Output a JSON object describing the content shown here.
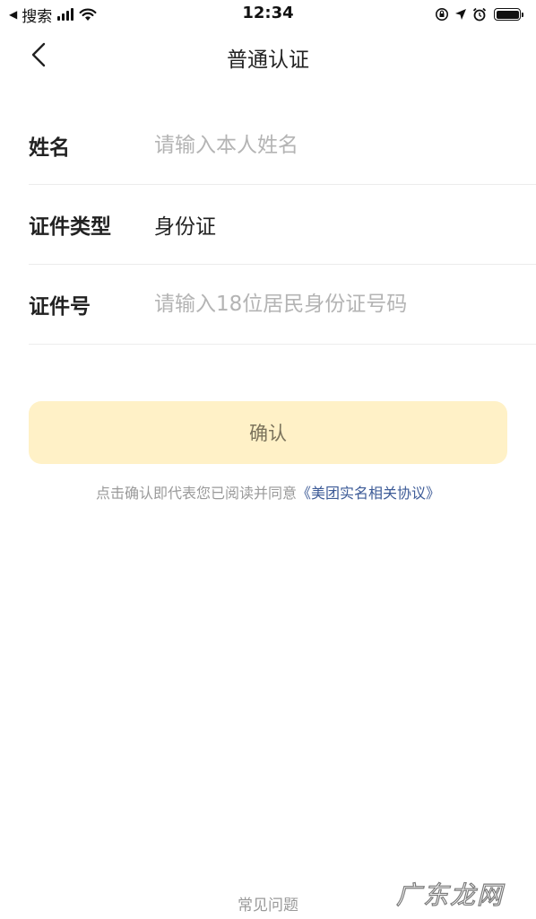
{
  "status_bar": {
    "back_app": "搜索",
    "time": "12:34",
    "icons": [
      "back-triangle-icon",
      "cellular-signal-icon",
      "wifi-icon",
      "orientation-lock-icon",
      "location-arrow-icon",
      "alarm-icon",
      "battery-icon"
    ],
    "battery_level": 1.0
  },
  "nav": {
    "title": "普通认证",
    "back_icon": "chevron-left-icon"
  },
  "form": {
    "name": {
      "label": "姓名",
      "placeholder": "请输入本人姓名",
      "value": ""
    },
    "id_type": {
      "label": "证件类型",
      "value": "身份证"
    },
    "id_number": {
      "label": "证件号",
      "placeholder": "请输入18位居民身份证号码",
      "value": ""
    }
  },
  "confirm": {
    "label": "确认",
    "background": "#fff1c7",
    "text_color": "#7b735c"
  },
  "agreement": {
    "prefix": "点击确认即代表您已阅读并同意",
    "link_text": "《美团实名相关协议》",
    "link_color": "#3d5b97"
  },
  "footer": {
    "faq": "常见问题"
  },
  "watermark": {
    "text": "广东龙网"
  }
}
